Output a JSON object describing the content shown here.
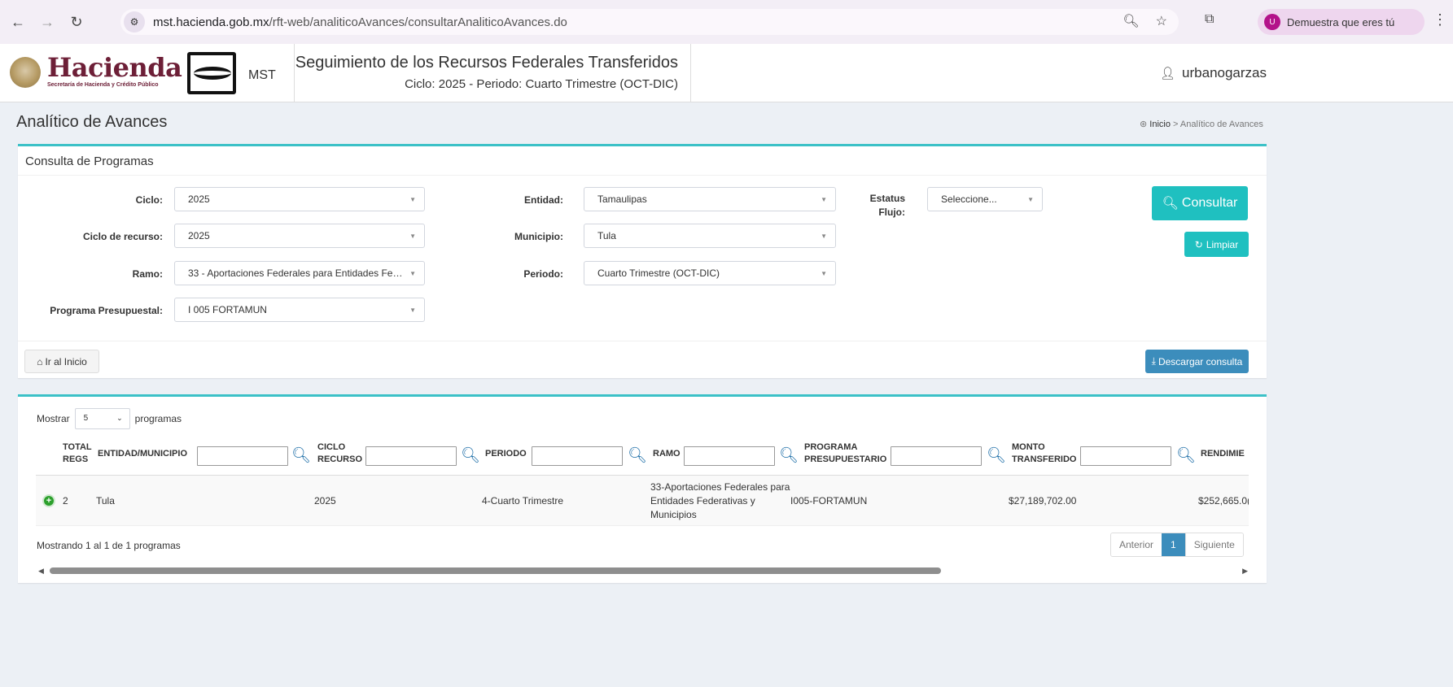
{
  "browser": {
    "url_host": "mst.hacienda.gob.mx",
    "url_path": "/rft-web/analiticoAvances/consultarAnaliticoAvances.do",
    "profile_label": "Demuestra que eres tú",
    "profile_initial": "U"
  },
  "header": {
    "brand_name": "Hacienda",
    "brand_sub": "Secretaría de Hacienda y Crédito Público",
    "mst_label": "MST",
    "system_title": "Seguimiento de los Recursos Federales Transferidos",
    "system_subtitle": "Ciclo: 2025 - Periodo: Cuarto Trimestre (OCT-DIC)",
    "username": "urbanogarzas"
  },
  "page": {
    "title": "Analítico de Avances",
    "breadcrumb_home": "Inicio",
    "breadcrumb_sep": ">",
    "breadcrumb_current": "Analítico de Avances"
  },
  "form": {
    "box_title": "Consulta de Programas",
    "ciclo_label": "Ciclo:",
    "ciclo_value": "2025",
    "ciclo_recurso_label": "Ciclo de recurso:",
    "ciclo_recurso_value": "2025",
    "ramo_label": "Ramo:",
    "ramo_value": "33 - Aportaciones Federales para Entidades Fe…",
    "programa_label": "Programa Presupuestal:",
    "programa_value": "I 005 FORTAMUN",
    "entidad_label": "Entidad:",
    "entidad_value": "Tamaulipas",
    "municipio_label": "Municipio:",
    "municipio_value": "Tula",
    "periodo_label": "Periodo:",
    "periodo_value": "Cuarto Trimestre (OCT-DIC)",
    "estatus_label_1": "Estatus",
    "estatus_label_2": "Flujo:",
    "estatus_value": "Seleccione...",
    "consultar_label": "Consultar",
    "limpiar_label": "Limpiar",
    "inicio_label": "Ir al Inicio",
    "descargar_label": "Descargar consulta"
  },
  "table": {
    "mostrar_label": "Mostrar",
    "length_value": "5",
    "programas_label": "programas",
    "headers": {
      "total_1": "TOTAL",
      "total_2": "REGS",
      "entidad": "ENTIDAD/MUNICIPIO",
      "ciclo_1": "CICLO",
      "ciclo_2": "RECURSO",
      "periodo": "PERIODO",
      "ramo": "RAMO",
      "programa_1": "PROGRAMA",
      "programa_2": "PRESUPUESTARIO",
      "monto_1": "MONTO",
      "monto_2": "TRANSFERIDO",
      "rendimientos": "RENDIMIE"
    },
    "rows": [
      {
        "total": "2",
        "entidad": "Tula",
        "ciclo": "2025",
        "periodo": "4-Cuarto Trimestre",
        "ramo_1": "33-Aportaciones Federales para",
        "ramo_2": "Entidades Federativas y",
        "ramo_3": "Municipios",
        "programa": "I005-FORTAMUN",
        "monto": "$27,189,702.00",
        "rendimientos": "$252,665.0("
      }
    ],
    "info": "Mostrando 1 al 1 de 1 programas",
    "pager_prev": "Anterior",
    "pager_current": "1",
    "pager_next": "Siguiente"
  }
}
